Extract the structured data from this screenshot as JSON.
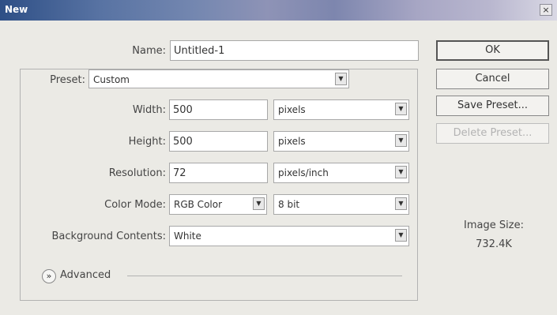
{
  "window": {
    "title": "New",
    "close_glyph": "×"
  },
  "form": {
    "name_label": "Name:",
    "name_value": "Untitled-1",
    "preset_label": "Preset:",
    "preset_value": "Custom",
    "width_label": "Width:",
    "width_value": "500",
    "width_unit": "pixels",
    "height_label": "Height:",
    "height_value": "500",
    "height_unit": "pixels",
    "resolution_label": "Resolution:",
    "resolution_value": "72",
    "resolution_unit": "pixels/inch",
    "color_mode_label": "Color Mode:",
    "color_mode_value": "RGB Color",
    "bit_depth_value": "8 bit",
    "background_label": "Background Contents:",
    "background_value": "White",
    "advanced_label": "Advanced",
    "advanced_toggle_glyph": "»"
  },
  "buttons": {
    "ok": "OK",
    "cancel": "Cancel",
    "save_preset": "Save Preset...",
    "delete_preset": "Delete Preset..."
  },
  "image_size": {
    "label": "Image Size:",
    "value": "732.4K"
  },
  "icons": {
    "dropdown_arrow": "▼"
  }
}
